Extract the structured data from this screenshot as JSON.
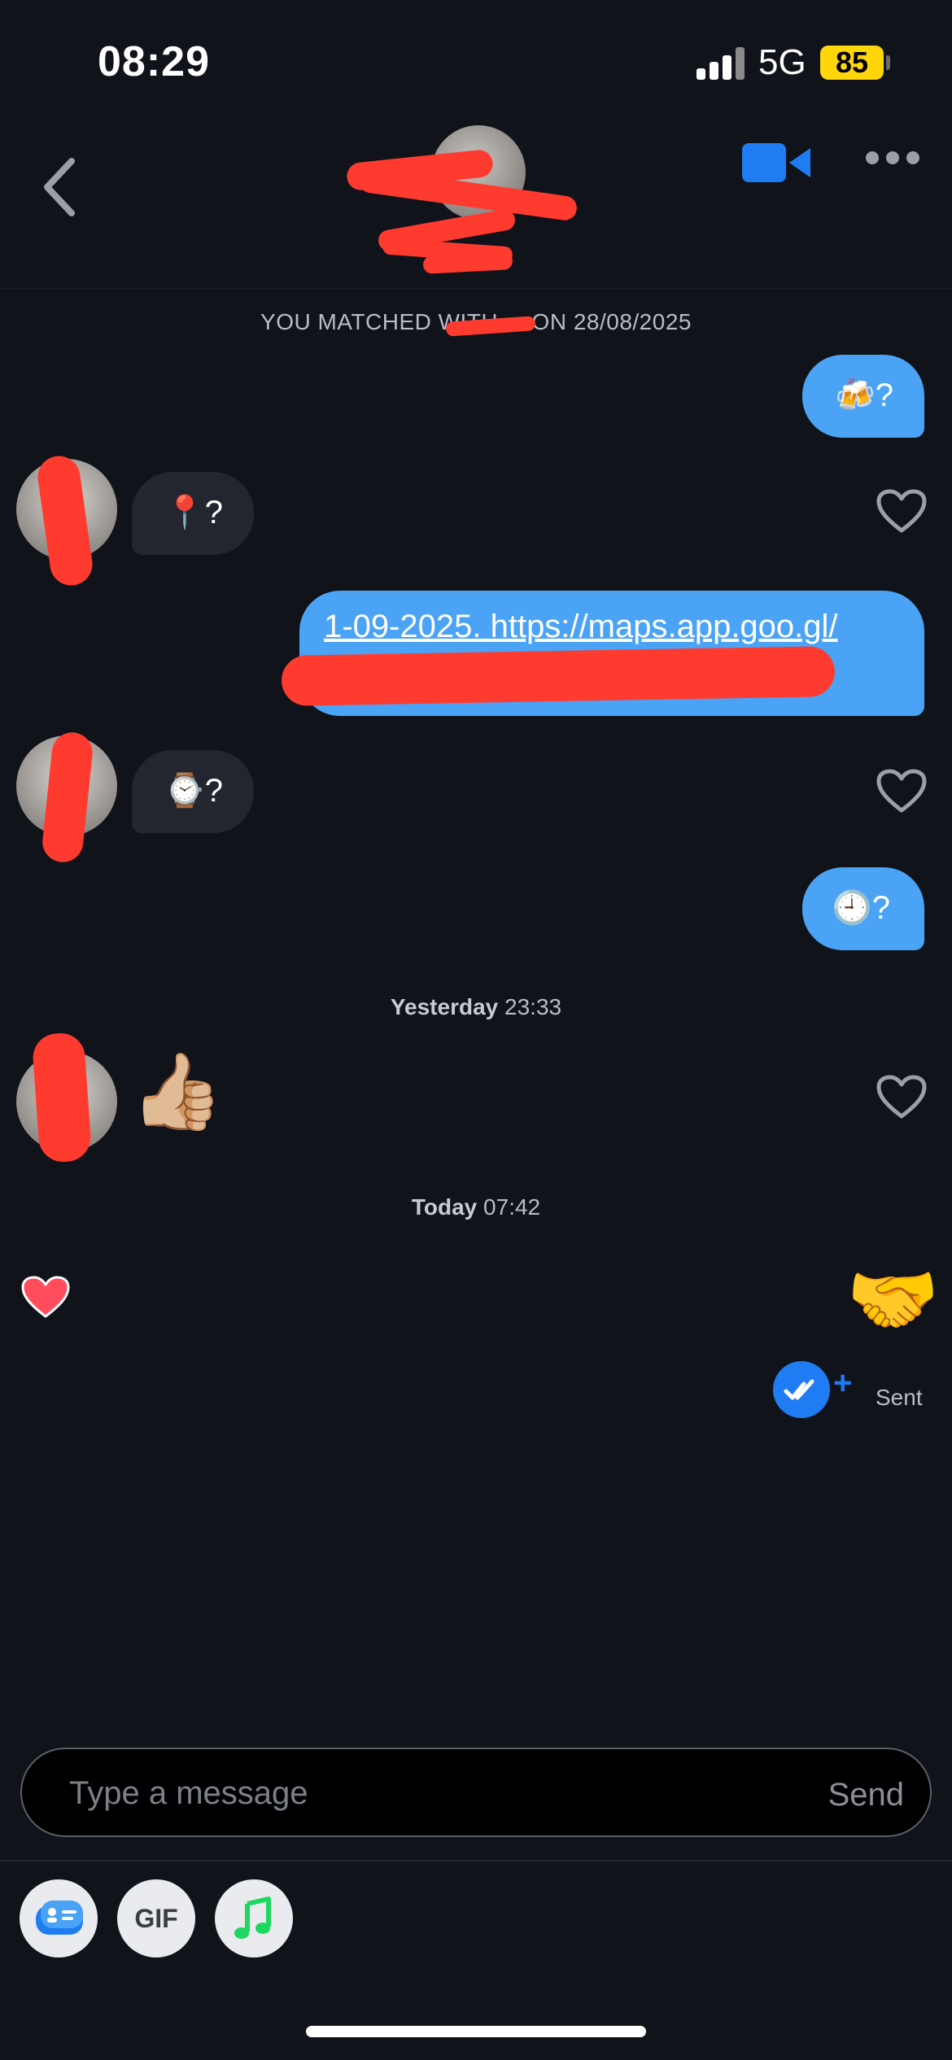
{
  "status_bar": {
    "time": "08:29",
    "network": "5G",
    "battery": "85"
  },
  "header": {
    "back_icon": "chevron-left-icon",
    "video_icon": "video-camera-icon",
    "more_icon": "ellipsis-icon",
    "accent_color": "#1f7cf3"
  },
  "match_banner": "YOU MATCHED WITH ... ON 28/08/2025",
  "messages": [
    {
      "direction": "out",
      "text": "🍻?"
    },
    {
      "direction": "in",
      "text": "📍?"
    },
    {
      "direction": "out",
      "text": "1-09-2025. https://maps.app.goo.gl/"
    },
    {
      "direction": "in",
      "text": "⌚?"
    },
    {
      "direction": "out",
      "text": "🕘?"
    },
    {
      "direction": "in",
      "text": "👍🏼"
    },
    {
      "direction": "out",
      "text": "🤝"
    }
  ],
  "separators": [
    {
      "day": "Yesterday",
      "time": "23:33"
    },
    {
      "day": "Today",
      "time": "07:42"
    }
  ],
  "status": {
    "sent_label": "Sent",
    "plus": "+"
  },
  "composer": {
    "placeholder": "Type a message",
    "send_label": "Send"
  },
  "toolbar": {
    "gif_label": "GIF",
    "icons": [
      "sticker-icon",
      "gif-icon",
      "music-note-icon"
    ]
  },
  "colors": {
    "outgoing_bubble": "#4aa3f5",
    "incoming_bubble": "#23262e",
    "background": "#10131a",
    "like_heart": "#ff4d5e"
  }
}
